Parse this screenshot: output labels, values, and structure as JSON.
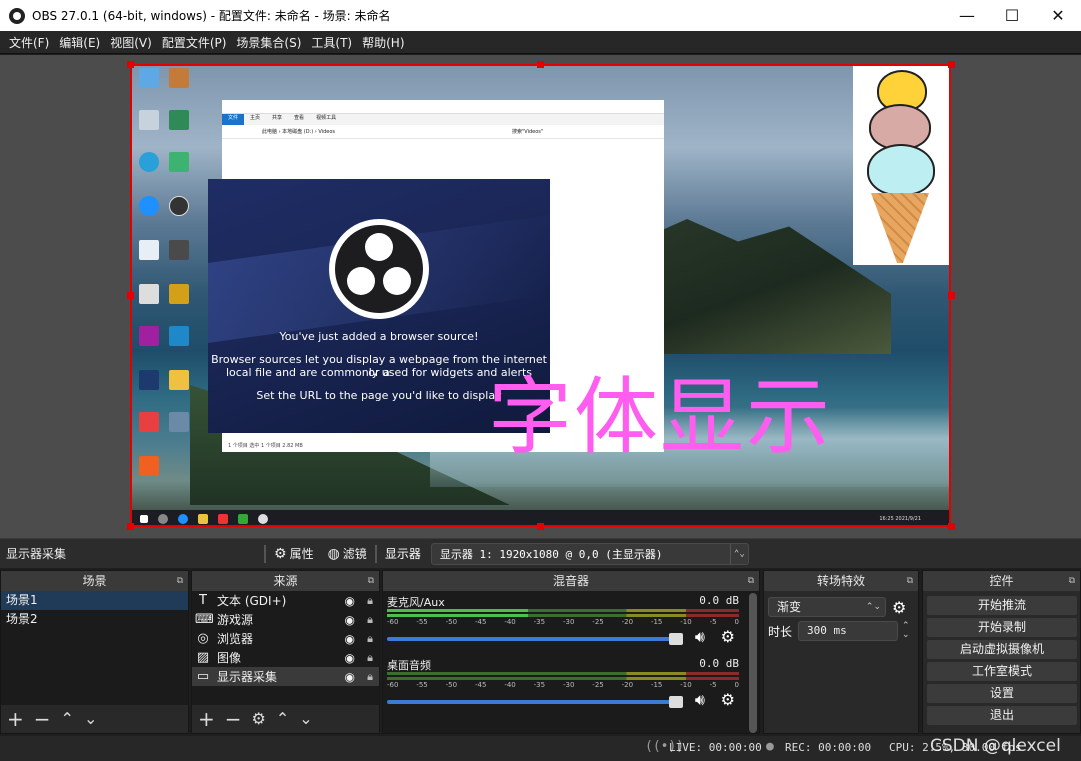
{
  "window": {
    "title": "OBS 27.0.1 (64-bit, windows) - 配置文件: 未命名 - 场景: 未命名",
    "minimize": "—",
    "maximize": "☐",
    "close": "✕"
  },
  "menu": [
    "文件(F)",
    "编辑(E)",
    "视图(V)",
    "配置文件(P)",
    "场景集合(S)",
    "工具(T)",
    "帮助(H)"
  ],
  "preview": {
    "welcome_heading": "You've just added a browser source!",
    "welcome_body_1": "Browser sources let you display a webpage from the internet or a",
    "welcome_body_2": "local file and are commonly used for widgets and alerts",
    "welcome_body_3": "Set the URL to the page you'd like to display",
    "overlay_text": "字体显示",
    "overlay_color": "#ff5cf0",
    "selection_color": "#e40000",
    "explorer_path": "此电脑 › 本地磁盘 (D:) › Videos",
    "explorer_search": "搜索\"Videos\"",
    "explorer_status": "1 个项目   选中 1 个项目  2.82 MB",
    "explorer_tabs": [
      "文件",
      "主页",
      "共享",
      "查看",
      "视频工具"
    ],
    "taskbar_clock": "16:25\n2021/9/21"
  },
  "source_toolbar": {
    "caption": "显示器采集",
    "properties": "属性",
    "filters": "滤镜",
    "display_label": "显示器",
    "display_value": "显示器 1: 1920x1080 @ 0,0 (主显示器)"
  },
  "scenes": {
    "title": "场景",
    "items": [
      "场景1",
      "场景2"
    ],
    "selected": 0
  },
  "sources": {
    "title": "来源",
    "items": [
      {
        "label": "文本 (GDI+)",
        "icon": "text-icon"
      },
      {
        "label": "游戏源",
        "icon": "gamepad-icon"
      },
      {
        "label": "浏览器",
        "icon": "globe-icon"
      },
      {
        "label": "图像",
        "icon": "image-icon"
      },
      {
        "label": "显示器采集",
        "icon": "monitor-icon"
      }
    ],
    "selected": 4
  },
  "mixer": {
    "title": "混音器",
    "ticks": [
      "-60",
      "-55",
      "-50",
      "-45",
      "-40",
      "-35",
      "-30",
      "-25",
      "-20",
      "-15",
      "-10",
      "-5",
      "0"
    ],
    "channels": [
      {
        "name": "麦克风/Aux",
        "db": "0.0 dB"
      },
      {
        "name": "桌面音频",
        "db": "0.0 dB"
      }
    ]
  },
  "transitions": {
    "title": "转场特效",
    "type": "渐变",
    "duration_label": "时长",
    "duration_value": "300 ms"
  },
  "controls": {
    "title": "控件",
    "buttons": [
      "开始推流",
      "开始录制",
      "启动虚拟摄像机",
      "工作室模式",
      "设置",
      "退出"
    ]
  },
  "status": {
    "live": "LIVE: 00:00:00",
    "rec": "REC: 00:00:00",
    "cpu": "CPU: 2.5%, 30.00 fps",
    "watermark": "CSDN @qlexcel"
  }
}
